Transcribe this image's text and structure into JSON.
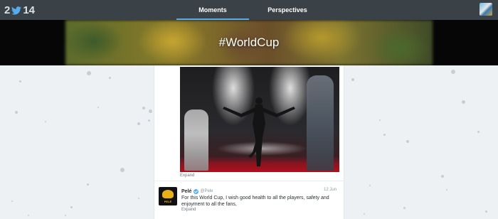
{
  "topbar": {
    "logo_left": "2",
    "logo_right": "14",
    "tabs": [
      {
        "label": "Moments",
        "active": true
      },
      {
        "label": "Perspectives",
        "active": false
      }
    ],
    "accent_color": "#55acee"
  },
  "banner": {
    "title": "#WorldCup"
  },
  "feed": {
    "photo_card": {
      "expand_label": "Expand"
    },
    "tweet": {
      "name": "Pelé",
      "handle": "@Pele",
      "date": "12 Jun",
      "text": "For this World Cup, I wish good health to all the players, safety and enjoyment to all the fans,",
      "expand_label": "Expand",
      "avatar_text": "PELÉ"
    }
  }
}
